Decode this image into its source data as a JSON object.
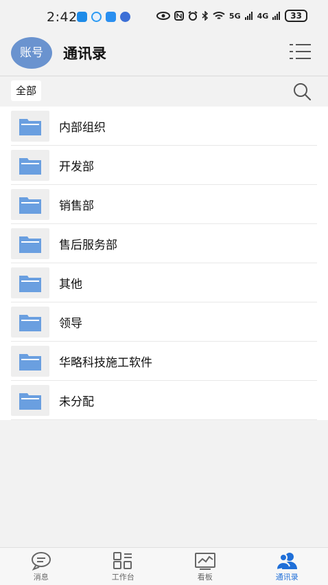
{
  "status": {
    "time": "2:42",
    "signal1": "5G",
    "signal2": "4G",
    "battery": "33"
  },
  "header": {
    "avatar_text": "账号",
    "title": "通讯录"
  },
  "filter": {
    "chip_label": "全部"
  },
  "list": {
    "items": [
      {
        "label": "内部组织"
      },
      {
        "label": "开发部"
      },
      {
        "label": "销售部"
      },
      {
        "label": "售后服务部"
      },
      {
        "label": "其他"
      },
      {
        "label": "领导"
      },
      {
        "label": "华略科技施工软件"
      },
      {
        "label": "未分配"
      }
    ]
  },
  "nav": {
    "items": [
      {
        "label": "消息",
        "icon": "message-icon"
      },
      {
        "label": "工作台",
        "icon": "workbench-icon"
      },
      {
        "label": "看板",
        "icon": "dashboard-icon"
      },
      {
        "label": "通讯录",
        "icon": "contacts-icon",
        "active": true
      }
    ]
  },
  "colors": {
    "accent": "#1f6fd8",
    "folder": "#6a9fe0",
    "avatar": "#6a93cf"
  }
}
